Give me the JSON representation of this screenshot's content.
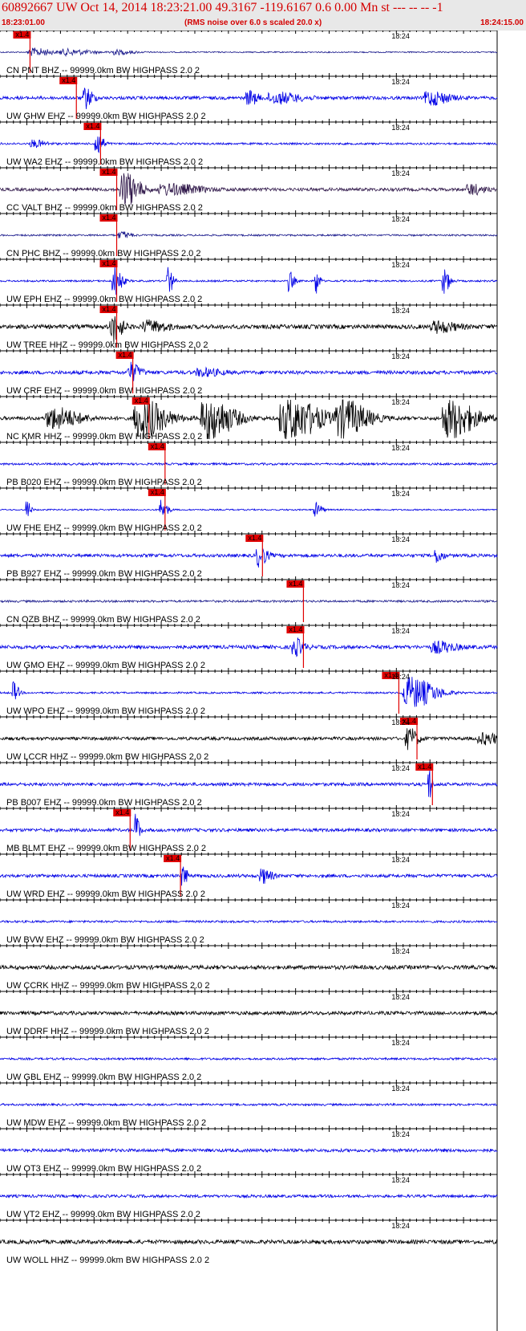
{
  "header": {
    "title": "60892667 UW Oct 14, 2014 18:23:21.00   49.3167 -119.6167  0.6 0.00 Mn st --- -- --  -1",
    "start_time": "18:23:01.00",
    "note": "(RMS noise over 6.0 s scaled 20.0 x)",
    "end_time": "18:24:15.00"
  },
  "chart_data": {
    "type": "line",
    "title": "60892667 UW Oct 14, 2014 18:23:21.00   49.3167 -119.6167  0.6 0.00 Mn st --- -- --  -1",
    "time_start_s": 61.0,
    "time_end_s": 135.0,
    "minute_label": "18:24",
    "minute_mark_s": 120.0,
    "pick_label": "x1.4",
    "colors": {
      "pick": "#e00000",
      "grid": "#000000"
    },
    "traces": [
      {
        "label": "CN PNT BHZ -- 99999.0km BW  HIGHPASS  2.0  2",
        "color": "#1a1a8c",
        "pick_s": 63.2,
        "amp": 0.35,
        "bursts": [
          [
            66,
            3,
            2.2
          ],
          [
            71,
            4,
            1.6
          ],
          [
            78,
            3,
            1.3
          ]
        ]
      },
      {
        "label": "UW GHW EHZ -- 99999.0km BW  HIGHPASS  2.0  2",
        "color": "#0000e6",
        "pick_s": 70.1,
        "amp": 0.9,
        "bursts": [
          [
            73.7,
            1.2,
            6
          ],
          [
            98,
            1.5,
            4
          ],
          [
            102,
            4,
            3
          ],
          [
            125,
            3,
            4
          ]
        ]
      },
      {
        "label": "UW WA2 EHZ -- 99999.0km BW  HIGHPASS  2.0  2",
        "color": "#0000e6",
        "pick_s": 73.7,
        "amp": 0.55,
        "bursts": [
          [
            75.3,
            1.1,
            7
          ],
          [
            66,
            2,
            2
          ]
        ]
      },
      {
        "label": "CC VALT BHZ -- 99999.0km BW  HIGHPASS  2.0  2",
        "color": "#30184a",
        "pick_s": 76.1,
        "amp": 0.9,
        "bursts": [
          [
            79.5,
            2.4,
            10
          ],
          [
            86,
            5,
            3
          ],
          [
            131,
            2,
            3
          ]
        ]
      },
      {
        "label": "CN PHC BHZ -- 99999.0km BW  HIGHPASS  2.0  2",
        "color": "#1a1a8c",
        "pick_s": 76.1,
        "amp": 0.5,
        "bursts": [
          [
            79,
            1.5,
            2
          ]
        ]
      },
      {
        "label": "UW EPH EHZ -- 99999.0km BW  HIGHPASS  2.0  2",
        "color": "#0000e6",
        "pick_s": 76.1,
        "amp": 0.5,
        "bursts": [
          [
            78,
            1.2,
            9
          ],
          [
            86,
            0.8,
            8
          ],
          [
            104,
            0.8,
            6
          ],
          [
            108,
            0.6,
            8
          ],
          [
            127,
            1,
            7
          ]
        ]
      },
      {
        "label": "UW TREE HHZ -- 99999.0km BW  HIGHPASS  2.0  2",
        "color": "#000000",
        "pick_s": 76.1,
        "amp": 1.2,
        "bursts": [
          [
            77.8,
            1.5,
            8
          ],
          [
            83,
            3,
            3
          ],
          [
            126,
            3,
            3
          ]
        ]
      },
      {
        "label": "UW CRF EHZ -- 99999.0km BW  HIGHPASS  2.0  2",
        "color": "#0000e6",
        "pick_s": 78.5,
        "amp": 1.0,
        "bursts": [
          [
            80.4,
            1.6,
            5
          ],
          [
            91,
            3,
            2
          ]
        ]
      },
      {
        "label": "NC KMR HHZ -- 99999.0km BW  HIGHPASS  2.0  2",
        "color": "#000000",
        "pick_s": 80.9,
        "amp": 1.0,
        "bursts": [
          [
            69,
            4,
            6
          ],
          [
            82,
            4,
            11
          ],
          [
            92,
            4,
            12
          ],
          [
            104,
            5,
            12
          ],
          [
            112,
            4,
            10
          ],
          [
            128,
            4,
            11
          ]
        ]
      },
      {
        "label": "PB B020 EHZ -- 99999.0km BW  HIGHPASS  2.0  2",
        "color": "#0000e6",
        "pick_s": 83.3,
        "amp": 0.6,
        "bursts": []
      },
      {
        "label": "UW FHE EHZ -- 99999.0km BW  HIGHPASS  2.0  2",
        "color": "#0000e6",
        "pick_s": 83.3,
        "amp": 0.4,
        "bursts": [
          [
            65,
            0.6,
            6
          ],
          [
            85,
            1,
            6
          ],
          [
            108,
            1,
            4
          ]
        ]
      },
      {
        "label": "PB B927 EHZ -- 99999.0km BW  HIGHPASS  2.0  2",
        "color": "#0000e6",
        "pick_s": 97.8,
        "amp": 0.9,
        "bursts": [
          [
            99.5,
            1.3,
            6
          ],
          [
            126,
            1,
            4
          ]
        ]
      },
      {
        "label": "CN OZB BHZ -- 99999.0km BW  HIGHPASS  2.0  2",
        "color": "#1a1a8c",
        "pick_s": 103.9,
        "amp": 0.6,
        "bursts": []
      },
      {
        "label": "UW GMO EHZ -- 99999.0km BW  HIGHPASS  2.0  2",
        "color": "#0000e6",
        "pick_s": 103.9,
        "amp": 1.0,
        "bursts": [
          [
            104.8,
            1.5,
            5
          ],
          [
            126,
            3,
            3
          ]
        ]
      },
      {
        "label": "UW WPO EHZ -- 99999.0km BW  HIGHPASS  2.0  2",
        "color": "#0000e6",
        "pick_s": 118.1,
        "amp": 0.5,
        "bursts": [
          [
            63,
            0.8,
            6
          ],
          [
            122,
            4,
            9
          ]
        ]
      },
      {
        "label": "UW LCCR HHZ -- 99999.0km BW  HIGHPASS  2.0  2",
        "color": "#000000",
        "pick_s": 120.8,
        "amp": 0.9,
        "bursts": [
          [
            121.8,
            1.5,
            6
          ],
          [
            133,
            3,
            3
          ]
        ]
      },
      {
        "label": "PB B007 EHZ -- 99999.0km BW  HIGHPASS  2.0  2",
        "color": "#0000e6",
        "pick_s": 123.1,
        "amp": 0.9,
        "bursts": [
          [
            124.8,
            0.5,
            10
          ]
        ]
      },
      {
        "label": "MB BLMT EHZ -- 99999.0km BW  HIGHPASS  2.0  2",
        "color": "#0000e6",
        "pick_s": 78.1,
        "amp": 0.9,
        "bursts": [
          [
            81.2,
            0.6,
            10
          ]
        ]
      },
      {
        "label": "UW WRD EHZ -- 99999.0km BW  HIGHPASS  2.0  2",
        "color": "#0000e6",
        "pick_s": 85.6,
        "amp": 0.9,
        "bursts": [
          [
            88.2,
            0.6,
            8
          ],
          [
            100,
            1.5,
            4
          ]
        ]
      },
      {
        "label": "UW BVW EHZ -- 99999.0km BW  HIGHPASS  2.0  2",
        "color": "#0000e6",
        "amp": 0.6,
        "bursts": []
      },
      {
        "label": "UW CCRK HHZ -- 99999.0km BW  HIGHPASS  2.0  2",
        "color": "#000000",
        "amp": 1.1,
        "bursts": []
      },
      {
        "label": "UW DDRF HHZ -- 99999.0km BW  HIGHPASS  2.0  2",
        "color": "#000000",
        "amp": 1.0,
        "bursts": []
      },
      {
        "label": "UW GBL EHZ -- 99999.0km BW  HIGHPASS  2.0  2",
        "color": "#0000e6",
        "amp": 0.6,
        "bursts": []
      },
      {
        "label": "UW MDW EHZ -- 99999.0km BW  HIGHPASS  2.0  2",
        "color": "#0000e6",
        "amp": 0.6,
        "bursts": []
      },
      {
        "label": "UW OT3 EHZ -- 99999.0km BW  HIGHPASS  2.0  2",
        "color": "#0000e6",
        "amp": 0.9,
        "bursts": []
      },
      {
        "label": "UW VT2 EHZ -- 99999.0km BW  HIGHPASS  2.0  2",
        "color": "#0000e6",
        "amp": 0.8,
        "bursts": []
      },
      {
        "label": "UW WOLL HHZ -- 99999.0km BW  HIGHPASS  2.0  2",
        "color": "#000000",
        "amp": 1.1,
        "bursts": []
      }
    ]
  }
}
